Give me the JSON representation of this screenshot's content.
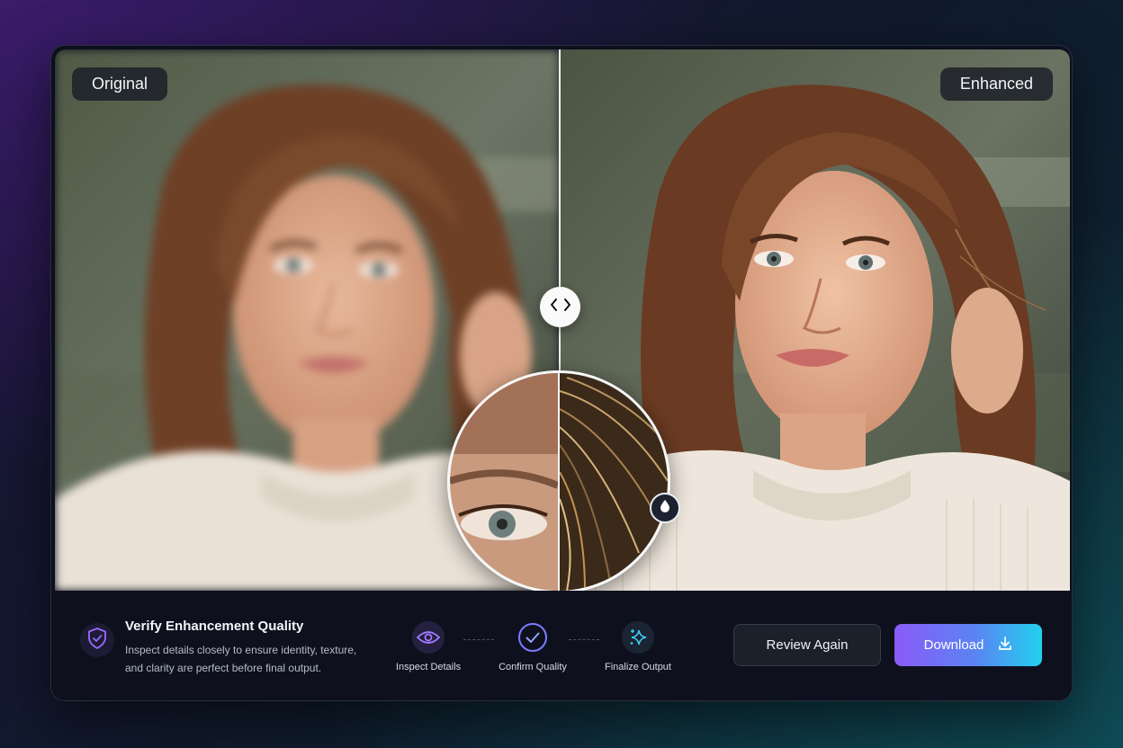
{
  "compare": {
    "label_left": "Original",
    "label_right": "Enhanced"
  },
  "footer": {
    "title": "Verify Enhancement Quality",
    "description": "Inspect details closely to ensure identity, texture, and clarity are perfect before final output.",
    "steps": [
      {
        "label": "Inspect Details",
        "icon": "eye-icon"
      },
      {
        "label": "Confirm Quality",
        "icon": "check-circle-icon"
      },
      {
        "label": "Finalize Output",
        "icon": "sparkle-icon"
      }
    ],
    "review_label": "Review Again",
    "download_label": "Download"
  },
  "colors": {
    "accent_purple": "#8a5bf7",
    "accent_cyan": "#21d1ee",
    "panel_bg": "#0e111d"
  }
}
